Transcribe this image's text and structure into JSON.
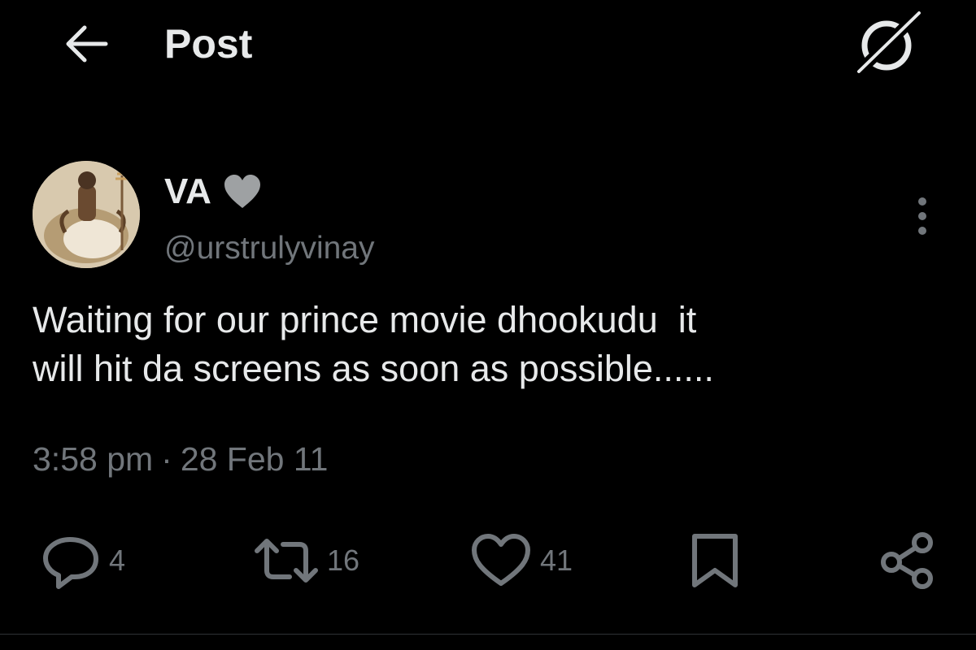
{
  "header": {
    "title": "Post",
    "back_icon": "arrow-left-icon",
    "grok_icon": "grok-icon"
  },
  "author": {
    "name": "VA",
    "name_emoji": "grey-heart-icon",
    "handle": "@urstrulyvinay",
    "avatar_icon": "avatar"
  },
  "post": {
    "text": "Waiting for our prince movie dhookudu  it\nwill hit da screens as soon as possible......",
    "time": "3:58 pm",
    "separator": "·",
    "date": "28 Feb 11"
  },
  "actions": {
    "reply_count": "4",
    "repost_count": "16",
    "like_count": "41"
  },
  "colors": {
    "background": "#000000",
    "primary_text": "#e7e9ea",
    "secondary_text": "#71767b"
  }
}
